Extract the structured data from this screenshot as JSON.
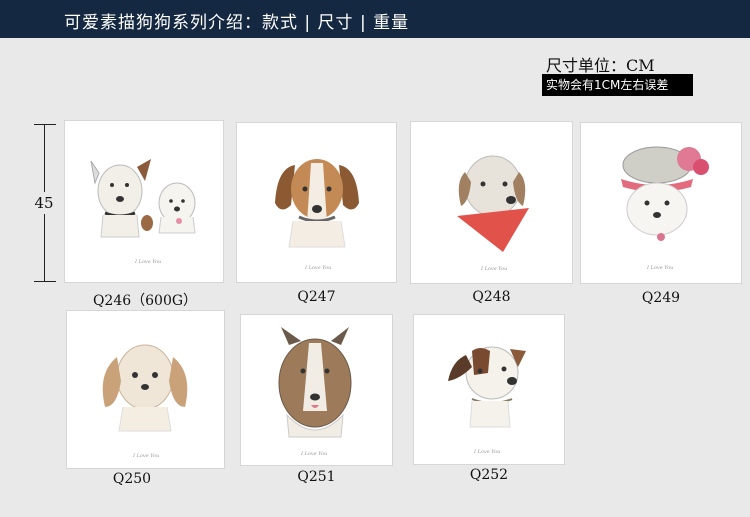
{
  "header": {
    "title": "可爱素描狗狗系列介绍：款式 | 尺寸 | 重量"
  },
  "unit": {
    "label": "尺寸单位：CM",
    "tolerance": "实物会有1CM左右误差"
  },
  "dimension": {
    "value": "45"
  },
  "products": [
    {
      "code": "Q246（600G）",
      "signature": "I Love You"
    },
    {
      "code": "Q247",
      "signature": "I Love You"
    },
    {
      "code": "Q248",
      "signature": "I Love You"
    },
    {
      "code": "Q249",
      "signature": "I Love You"
    },
    {
      "code": "Q250",
      "signature": "I Love You"
    },
    {
      "code": "Q251",
      "signature": "I Love You"
    },
    {
      "code": "Q252",
      "signature": "I Love You"
    }
  ],
  "colors": {
    "header": "#152841",
    "background": "#e9e9e9"
  }
}
